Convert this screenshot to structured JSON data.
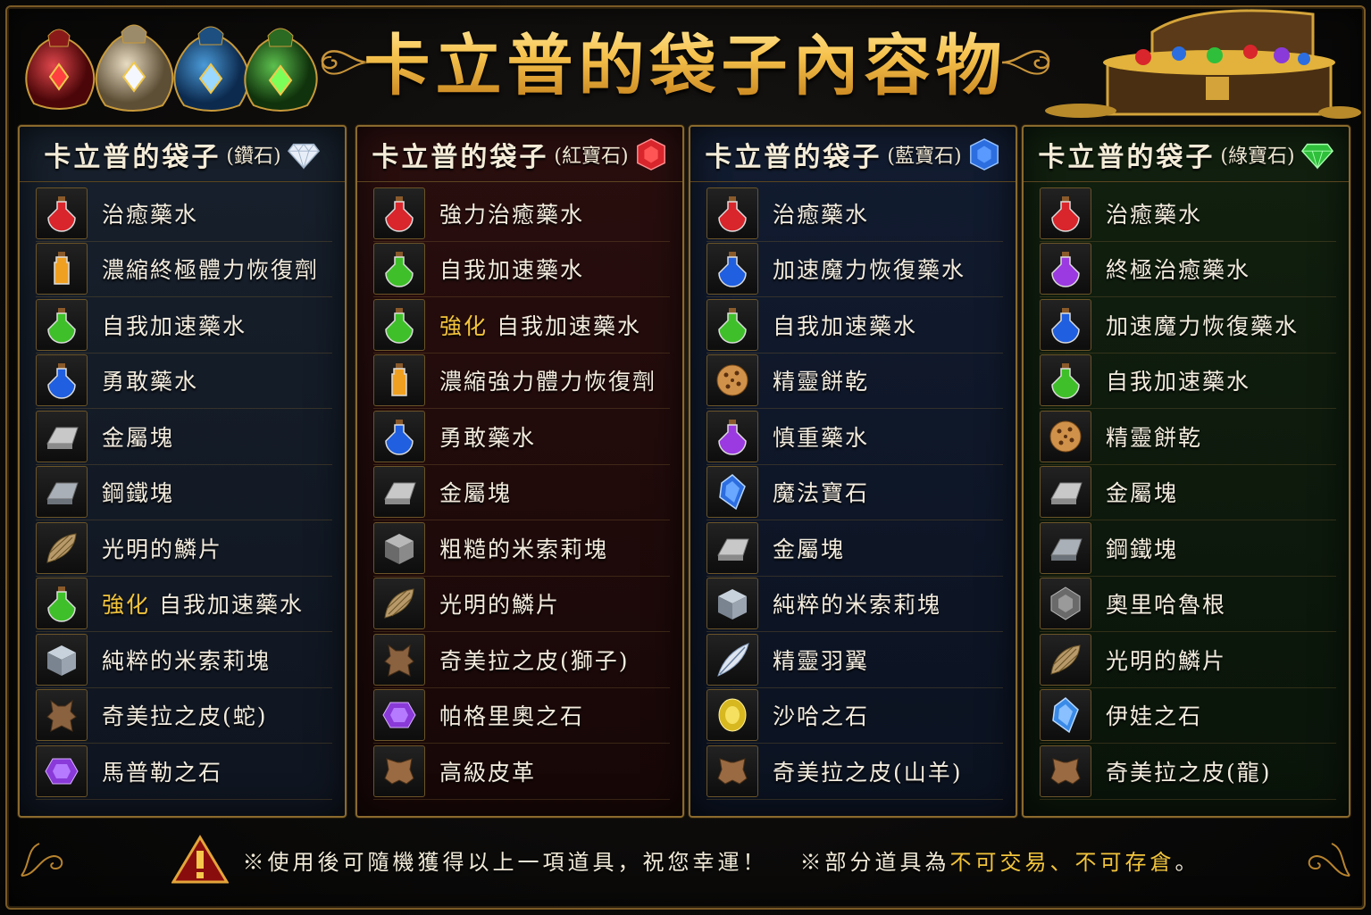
{
  "title": "卡立普的袋子內容物",
  "colors": {
    "gold": "#f2c43b",
    "diamond": "#dfe8f5",
    "ruby": "#d8262c",
    "sapphire": "#2c6ee0",
    "emerald": "#2fbf3b"
  },
  "columns": [
    {
      "name": "卡立普的袋子",
      "subtitle": "(鑽石)",
      "gem_icon": "diamond-icon",
      "items": [
        {
          "icon": "red-potion-icon",
          "enhanced": "",
          "label": "治癒藥水"
        },
        {
          "icon": "orange-potion-icon",
          "enhanced": "",
          "label": "濃縮終極體力恢復劑"
        },
        {
          "icon": "green-potion-icon",
          "enhanced": "",
          "label": "自我加速藥水"
        },
        {
          "icon": "blue-potion-icon",
          "enhanced": "",
          "label": "勇敢藥水"
        },
        {
          "icon": "metal-ingot-icon",
          "enhanced": "",
          "label": "金屬塊"
        },
        {
          "icon": "steel-ingot-icon",
          "enhanced": "",
          "label": "鋼鐵塊"
        },
        {
          "icon": "scale-icon",
          "enhanced": "",
          "label": "光明的鱗片"
        },
        {
          "icon": "green-potion-icon",
          "enhanced": "強化",
          "label": "自我加速藥水"
        },
        {
          "icon": "mithril-block-icon",
          "enhanced": "",
          "label": "純粹的米索莉塊"
        },
        {
          "icon": "hide-icon",
          "enhanced": "",
          "label": "奇美拉之皮(蛇)"
        },
        {
          "icon": "purple-stone-icon",
          "enhanced": "",
          "label": "馬普勒之石"
        }
      ]
    },
    {
      "name": "卡立普的袋子",
      "subtitle": "(紅寶石)",
      "gem_icon": "ruby-icon",
      "items": [
        {
          "icon": "red-potion-icon",
          "enhanced": "",
          "label": "強力治癒藥水"
        },
        {
          "icon": "green-potion-icon",
          "enhanced": "",
          "label": "自我加速藥水"
        },
        {
          "icon": "green-potion-icon",
          "enhanced": "強化",
          "label": "自我加速藥水"
        },
        {
          "icon": "orange-potion-icon",
          "enhanced": "",
          "label": "濃縮強力體力恢復劑"
        },
        {
          "icon": "blue-potion-icon",
          "enhanced": "",
          "label": "勇敢藥水"
        },
        {
          "icon": "metal-ingot-icon",
          "enhanced": "",
          "label": "金屬塊"
        },
        {
          "icon": "mithril-block-icon",
          "enhanced": "",
          "label": "粗糙的米索莉塊"
        },
        {
          "icon": "scale-icon",
          "enhanced": "",
          "label": "光明的鱗片"
        },
        {
          "icon": "hide-icon",
          "enhanced": "",
          "label": "奇美拉之皮(獅子)"
        },
        {
          "icon": "purple-stone-icon",
          "enhanced": "",
          "label": "帕格里奧之石"
        },
        {
          "icon": "leather-icon",
          "enhanced": "",
          "label": "高級皮革"
        }
      ]
    },
    {
      "name": "卡立普的袋子",
      "subtitle": "(藍寶石)",
      "gem_icon": "sapphire-icon",
      "items": [
        {
          "icon": "red-potion-icon",
          "enhanced": "",
          "label": "治癒藥水"
        },
        {
          "icon": "blue-potion-icon",
          "enhanced": "",
          "label": "加速魔力恢復藥水"
        },
        {
          "icon": "green-potion-icon",
          "enhanced": "",
          "label": "自我加速藥水"
        },
        {
          "icon": "cookie-icon",
          "enhanced": "",
          "label": "精靈餅乾"
        },
        {
          "icon": "purple-potion-icon",
          "enhanced": "",
          "label": "慎重藥水"
        },
        {
          "icon": "blue-gem-icon",
          "enhanced": "",
          "label": "魔法寶石"
        },
        {
          "icon": "metal-ingot-icon",
          "enhanced": "",
          "label": "金屬塊"
        },
        {
          "icon": "mithril-block-icon",
          "enhanced": "",
          "label": "純粹的米索莉塊"
        },
        {
          "icon": "feather-icon",
          "enhanced": "",
          "label": "精靈羽翼"
        },
        {
          "icon": "yellow-stone-icon",
          "enhanced": "",
          "label": "沙哈之石"
        },
        {
          "icon": "leather-icon",
          "enhanced": "",
          "label": "奇美拉之皮(山羊)"
        }
      ]
    },
    {
      "name": "卡立普的袋子",
      "subtitle": "(綠寶石)",
      "gem_icon": "emerald-icon",
      "items": [
        {
          "icon": "red-potion-icon",
          "enhanced": "",
          "label": "治癒藥水"
        },
        {
          "icon": "purple-potion-icon",
          "enhanced": "",
          "label": "終極治癒藥水"
        },
        {
          "icon": "blue-potion-icon",
          "enhanced": "",
          "label": "加速魔力恢復藥水"
        },
        {
          "icon": "green-potion-icon",
          "enhanced": "",
          "label": "自我加速藥水"
        },
        {
          "icon": "cookie-icon",
          "enhanced": "",
          "label": "精靈餅乾"
        },
        {
          "icon": "metal-ingot-icon",
          "enhanced": "",
          "label": "金屬塊"
        },
        {
          "icon": "steel-ingot-icon",
          "enhanced": "",
          "label": "鋼鐵塊"
        },
        {
          "icon": "root-icon",
          "enhanced": "",
          "label": "奧里哈魯根"
        },
        {
          "icon": "scale-icon",
          "enhanced": "",
          "label": "光明的鱗片"
        },
        {
          "icon": "blue-gem-icon",
          "enhanced": "",
          "label": "伊娃之石"
        },
        {
          "icon": "leather-icon",
          "enhanced": "",
          "label": "奇美拉之皮(龍)"
        }
      ]
    }
  ],
  "footer": {
    "note1": "※使用後可隨機獲得以上一項道具，祝您幸運！",
    "note2_prefix": "※部分道具為",
    "note2_highlight": "不可交易、不可存倉",
    "note2_suffix": "。"
  }
}
